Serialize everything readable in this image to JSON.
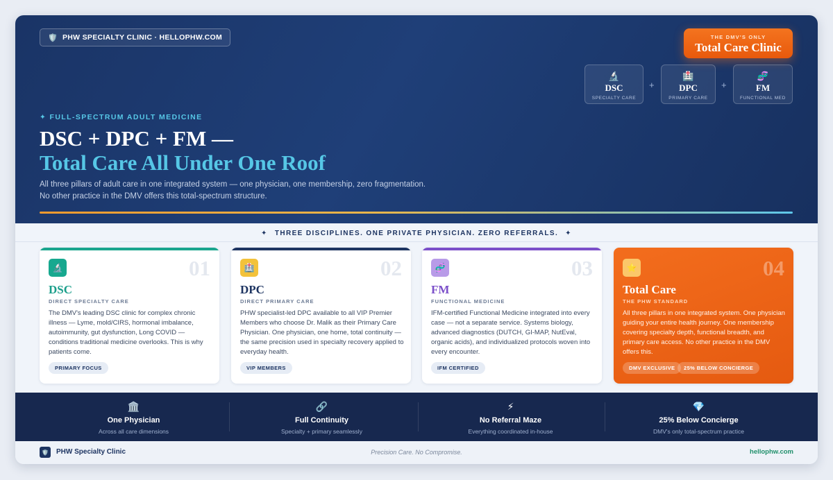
{
  "hero": {
    "brand": "PHW SPECIALTY CLINIC · HELLOPHW.COM",
    "badge_small": "THE DMV'S ONLY",
    "badge_big": "Total Care Clinic",
    "minis": [
      {
        "icon": "🔬",
        "title": "DSC",
        "sub": "SPECIALTY CARE"
      },
      {
        "icon": "🏥",
        "title": "DPC",
        "sub": "PRIMARY CARE"
      },
      {
        "icon": "🧬",
        "title": "FM",
        "sub": "FUNCTIONAL MED"
      }
    ],
    "plus": "+",
    "eyebrow": "✦ FULL-SPECTRUM ADULT MEDICINE",
    "headline_1": "DSC + DPC + FM —",
    "headline_2": "Total Care All Under One Roof",
    "lede": "All three pillars of adult care in one integrated system — one physician, one membership, zero fragmentation. No other practice in the DMV offers this total-spectrum structure."
  },
  "strip": {
    "star": "✦",
    "text": "THREE DISCIPLINES. ONE PRIVATE PHYSICIAN. ZERO REFERRALS."
  },
  "cards": [
    {
      "icon": "🔬",
      "num": "01",
      "title": "DSC",
      "sub": "DIRECT SPECIALTY CARE",
      "desc": "The DMV's leading DSC clinic for complex chronic illness — Lyme, mold/CIRS, hormonal imbalance, autoimmunity, gut dysfunction, Long COVID — conditions traditional medicine overlooks. This is why patients come.",
      "pills": [
        "PRIMARY FOCUS"
      ]
    },
    {
      "icon": "🏥",
      "num": "02",
      "title": "DPC",
      "sub": "DIRECT PRIMARY CARE",
      "desc": "PHW specialist-led DPC available to all VIP Premier Members who choose Dr. Malik as their Primary Care Physician. One physician, one home, total continuity — the same precision used in specialty recovery applied to everyday health.",
      "pills": [
        "VIP MEMBERS"
      ]
    },
    {
      "icon": "🧬",
      "num": "03",
      "title": "FM",
      "sub": "FUNCTIONAL MEDICINE",
      "desc": "IFM-certified Functional Medicine integrated into every case — not a separate service. Systems biology, advanced diagnostics (DUTCH, GI-MAP, NutEval, organic acids), and individualized protocols woven into every encounter.",
      "pills": [
        "IFM CERTIFIED"
      ]
    },
    {
      "icon": "⭐",
      "num": "04",
      "title": "Total Care",
      "sub": "THE PHW STANDARD",
      "desc": "All three pillars in one integrated system. One physician guiding your entire health journey. One membership covering specialty depth, functional breadth, and primary care access. No other practice in the DMV offers this.",
      "pills": [
        "DMV EXCLUSIVE",
        "25% BELOW CONCIERGE"
      ]
    }
  ],
  "stats": [
    {
      "icon": "🏛️",
      "title": "One Physician",
      "sub": "Across all care dimensions"
    },
    {
      "icon": "🔗",
      "title": "Full Continuity",
      "sub": "Specialty + primary seamlessly"
    },
    {
      "icon": "⚡",
      "title": "No Referral Maze",
      "sub": "Everything coordinated in-house"
    },
    {
      "icon": "💎",
      "title": "25% Below Concierge",
      "sub": "DMV's only total-spectrum practice"
    }
  ],
  "footer": {
    "logo_icon": "🛡️",
    "name": "PHW Specialty Clinic",
    "tagline": "Precision Care. No Compromise.",
    "url": "hellophw.com"
  },
  "colors": {
    "navy": "#1d3461",
    "cyan": "#56c7e6",
    "orange": "#e8590c",
    "dsc_accent": "#1a9e8a",
    "dpc_accent": "#1d3461",
    "fm_accent": "#7b4fc9",
    "url_green": "#1f8f6a"
  }
}
